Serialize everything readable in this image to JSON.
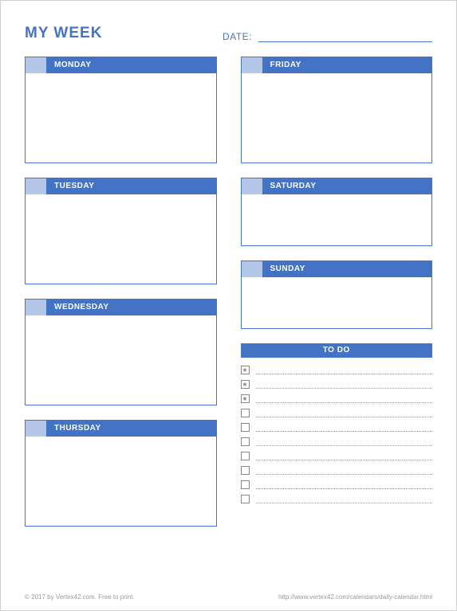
{
  "title": "MY WEEK",
  "date_label": "DATE:",
  "days": {
    "mon": "MONDAY",
    "tue": "TUESDAY",
    "wed": "WEDNESDAY",
    "thu": "THURSDAY",
    "fri": "FRIDAY",
    "sat": "SATURDAY",
    "sun": "SUNDAY"
  },
  "todo": {
    "header": "TO DO",
    "rows": [
      {
        "mark": "★"
      },
      {
        "mark": "★"
      },
      {
        "mark": "★"
      },
      {
        "mark": ""
      },
      {
        "mark": ""
      },
      {
        "mark": ""
      },
      {
        "mark": ""
      },
      {
        "mark": ""
      },
      {
        "mark": ""
      },
      {
        "mark": ""
      }
    ]
  },
  "footer": {
    "left": "© 2017 by Vertex42.com. Free to print.",
    "right": "http://www.vertex42.com/calendars/daily-calendar.html"
  }
}
